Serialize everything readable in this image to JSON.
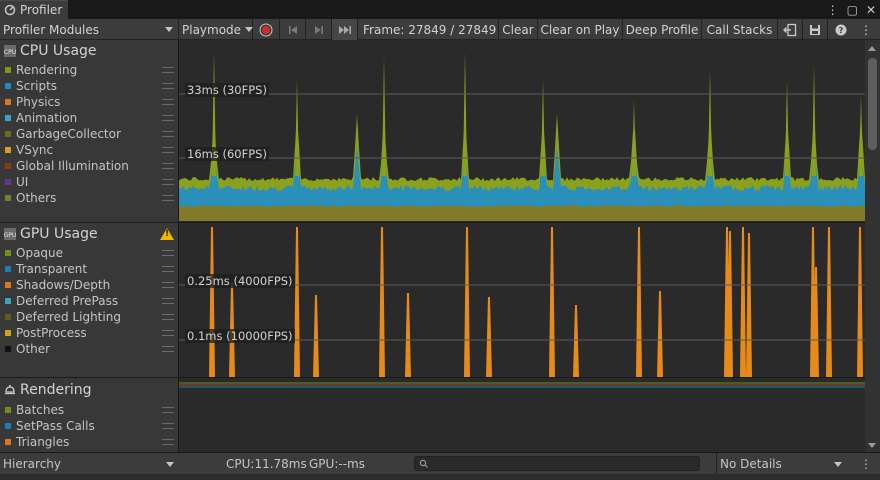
{
  "window": {
    "tab_label": "Profiler",
    "controls": {
      "more": "⋮",
      "maximize": "▢",
      "close": "✕"
    }
  },
  "toolbar": {
    "modules_dropdown": "Profiler Modules",
    "mode_dropdown": "Playmode",
    "frame_label": "Frame: 27849 / 27849",
    "clear": "Clear",
    "clear_on_play": "Clear on Play",
    "deep_profile": "Deep Profile",
    "call_stacks": "Call Stacks",
    "more": "⋮"
  },
  "modules": [
    {
      "title": "CPU Usage",
      "icon_text": "CPU",
      "legend": [
        {
          "label": "Rendering",
          "color": "#7f9a1a"
        },
        {
          "label": "Scripts",
          "color": "#1f8bc6"
        },
        {
          "label": "Physics",
          "color": "#d9781c"
        },
        {
          "label": "Animation",
          "color": "#3aa6be"
        },
        {
          "label": "GarbageCollector",
          "color": "#6e6a22"
        },
        {
          "label": "VSync",
          "color": "#c9a41c"
        },
        {
          "label": "Global Illumination",
          "color": "#8a3b14"
        },
        {
          "label": "UI",
          "color": "#5a3b8e"
        },
        {
          "label": "Others",
          "color": "#7a7a3a"
        }
      ],
      "markers": [
        "33ms (30FPS)",
        "16ms (60FPS)"
      ]
    },
    {
      "title": "GPU Usage",
      "icon_text": "GPU",
      "legend": [
        {
          "label": "Opaque",
          "color": "#6f8f1a"
        },
        {
          "label": "Transparent",
          "color": "#1f7ab6"
        },
        {
          "label": "Shadows/Depth",
          "color": "#d9781c"
        },
        {
          "label": "Deferred PrePass",
          "color": "#3aa6be"
        },
        {
          "label": "Deferred Lighting",
          "color": "#5f5a1e"
        },
        {
          "label": "PostProcess",
          "color": "#c9a41c"
        },
        {
          "label": "Other",
          "color": "#111111"
        }
      ],
      "markers": [
        "0.25ms (4000FPS)",
        "0.1ms (10000FPS)"
      ]
    },
    {
      "title": "Rendering",
      "legend": [
        {
          "label": "Batches",
          "color": "#6f8f1a"
        },
        {
          "label": "SetPass Calls",
          "color": "#1f7ab6"
        },
        {
          "label": "Triangles",
          "color": "#d9781c"
        }
      ]
    }
  ],
  "bottom": {
    "view_dropdown": "Hierarchy",
    "cpu": "CPU:11.78ms",
    "gpu": "GPU:--ms",
    "details_dropdown": "No Details",
    "more": "⋮"
  }
}
